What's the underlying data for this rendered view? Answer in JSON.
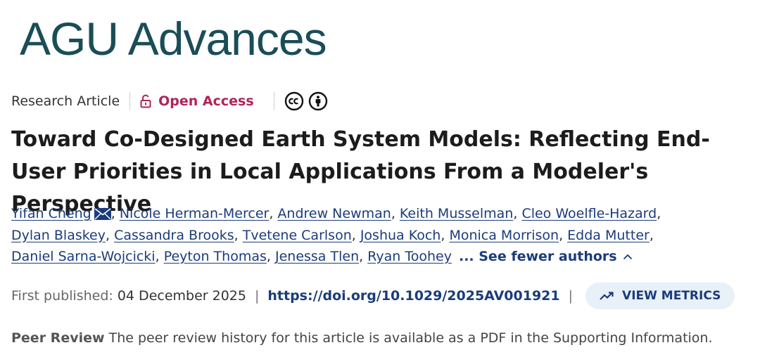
{
  "journal": {
    "name": "AGU Advances"
  },
  "article": {
    "type": "Research Article",
    "access": "Open Access",
    "title": "Toward Co-Designed Earth System Models: Reflecting End-User Priorities in Local Applications From a Modeler's Perspective"
  },
  "authors": [
    "Yifan Cheng",
    "Nicole Herman-Mercer",
    "Andrew Newman",
    "Keith Musselman",
    "Cleo Woelfle-Hazard",
    "Dylan Blaskey",
    "Cassandra Brooks",
    "Tvetene Carlson",
    "Joshua Koch",
    "Monica Morrison",
    "Edda Mutter",
    "Daniel Sarna-Wojcicki",
    "Peyton Thomas",
    "Jenessa Tlen",
    "Ryan Toohey"
  ],
  "authors_toggle": "... See fewer authors",
  "publication": {
    "label": "First published:",
    "date": "04 December 2025",
    "doi": "https://doi.org/10.1029/2025AV001921",
    "metrics_label": "VIEW METRICS"
  },
  "peer_review": {
    "label": "Peer Review",
    "text": "The peer review history for this article is available as a PDF in the Supporting Information."
  },
  "icons": {
    "open_access": "open-lock-icon",
    "license_cc": "creative-commons-icon",
    "license_by": "attribution-icon",
    "email": "envelope-icon",
    "toggle": "chevron-up-icon",
    "metrics": "trend-up-icon"
  },
  "colors": {
    "brand": "#1a4d57",
    "link": "#1b3c7a",
    "open_access": "#b2235a",
    "metrics_bg": "#e8f0f8"
  }
}
